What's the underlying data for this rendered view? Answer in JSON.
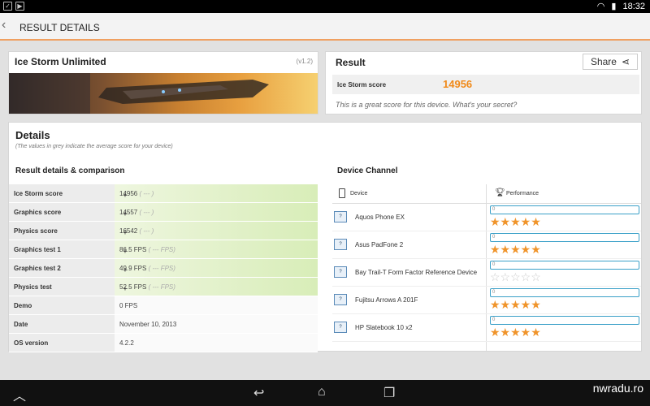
{
  "status_bar": {
    "time": "18:32",
    "wifi_icon": "wifi-icon",
    "battery_icon": "battery-icon"
  },
  "action_bar": {
    "title": "RESULT DETAILS"
  },
  "test_card": {
    "name": "Ice Storm Unlimited",
    "version": "(v1.2)"
  },
  "result_card": {
    "title": "Result",
    "share_label": "Share",
    "score_label": "Ice Storm score",
    "score_value": "14956",
    "note": "This is a great score for this device. What's your secret?"
  },
  "details": {
    "title": "Details",
    "subtitle": "(The values in grey indicate the average score for your device)",
    "comparison_title": "Result details & comparison",
    "rows": [
      {
        "label": "Ice Storm score",
        "value": "14956",
        "avg": "( --- )",
        "expandable": true
      },
      {
        "label": "Graphics score",
        "value": "14557",
        "avg": "( --- )",
        "expandable": true
      },
      {
        "label": "Physics score",
        "value": "16542",
        "avg": "( --- )",
        "expandable": true
      },
      {
        "label": "Graphics test 1",
        "value": "86.5 FPS",
        "avg": "( --- FPS)",
        "expandable": true
      },
      {
        "label": "Graphics test 2",
        "value": "49.9 FPS",
        "avg": "( --- FPS)",
        "expandable": true
      },
      {
        "label": "Physics test",
        "value": "52.5 FPS",
        "avg": "( --- FPS)",
        "expandable": true
      },
      {
        "label": "Demo",
        "value": "0 FPS",
        "avg": "",
        "expandable": false
      },
      {
        "label": "Date",
        "value": "November 10, 2013",
        "avg": "",
        "expandable": false
      },
      {
        "label": "OS version",
        "value": "4.2.2",
        "avg": "",
        "expandable": false
      }
    ]
  },
  "device_channel": {
    "title": "Device Channel",
    "col_device": "Device",
    "col_performance": "Performance",
    "devices": [
      {
        "name": "Aquos Phone EX",
        "bar_text": "0",
        "stars": 5
      },
      {
        "name": "Asus PadFone 2",
        "bar_text": "0",
        "stars": 5
      },
      {
        "name": "Bay Trail-T Form Factor Reference Device",
        "bar_text": "0",
        "stars": 0
      },
      {
        "name": "Fujitsu Arrows A 201F",
        "bar_text": "0",
        "stars": 5
      },
      {
        "name": "HP Slatebook 10 x2",
        "bar_text": "0",
        "stars": 5
      }
    ]
  },
  "nav_bar": {
    "icons": [
      "collapse-icon",
      "back-icon",
      "home-icon",
      "recents-icon"
    ]
  },
  "watermark": "nwradu.ro",
  "colors": {
    "accent": "#f08a1a",
    "highlight": "#d8edb8",
    "bar_border": "#3aa0c8"
  }
}
